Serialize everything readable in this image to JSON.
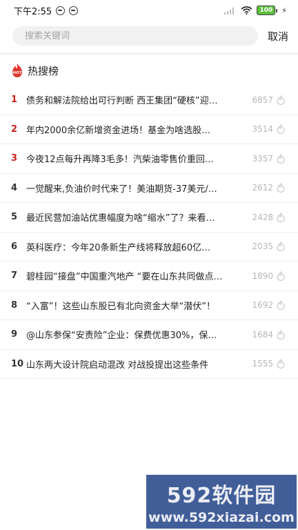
{
  "status_bar": {
    "time": "下午2:55",
    "battery": "100"
  },
  "search": {
    "placeholder": "搜索关键词",
    "cancel_label": "取消"
  },
  "hot": {
    "badge": "HOT",
    "title": "热搜榜",
    "items": [
      {
        "rank": "1",
        "title": "债务和解法院给出可行判断 西王集团“硬核”迎…",
        "count": "6857"
      },
      {
        "rank": "2",
        "title": "年内2000余亿新增资金进场！基金为啥选股…",
        "count": "3514"
      },
      {
        "rank": "3",
        "title": "今夜12点每升再降3毛多！汽柴油零售价重回…",
        "count": "3357"
      },
      {
        "rank": "4",
        "title": "一觉醒来,负油价时代来了！美油期货-37美元/…",
        "count": "2612"
      },
      {
        "rank": "5",
        "title": "最近民营加油站优惠幅度为啥“缩水”了？来看…",
        "count": "2428"
      },
      {
        "rank": "6",
        "title": "英科医疗：今年20条新生产线将释放超60亿…",
        "count": "2035"
      },
      {
        "rank": "7",
        "title": "碧桂园“接盘”中国重汽地产 “要在山东共同做点…",
        "count": "1890"
      },
      {
        "rank": "8",
        "title": "“入富”！这些山东股已有北向资金大举“潜伏”！",
        "count": "1692"
      },
      {
        "rank": "9",
        "title": "@山东参保“安责险”企业：保费优惠30%，保…",
        "count": "1684"
      },
      {
        "rank": "10",
        "title": "山东两大设计院启动混改 对战投提出这些条件",
        "count": "1555"
      }
    ]
  },
  "watermark": {
    "logo": "592软件园",
    "url": "www.592xiazai.com"
  },
  "colors": {
    "accent_red": "#c8201c",
    "watermark_blue": "#2e4d8f"
  }
}
